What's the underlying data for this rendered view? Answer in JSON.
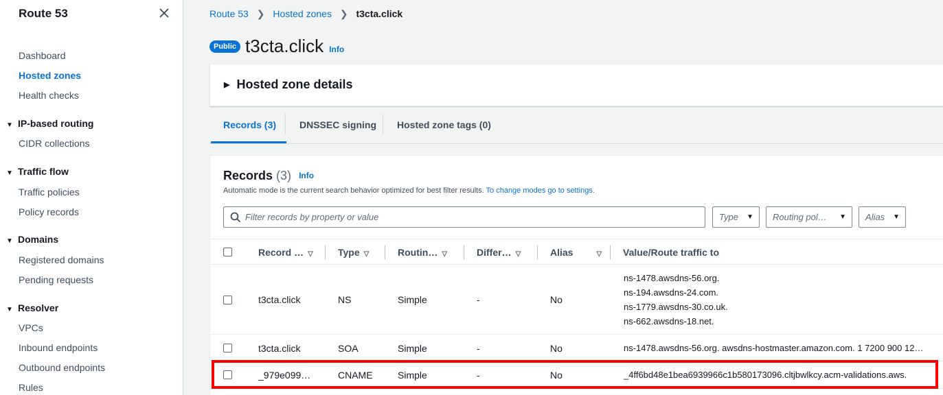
{
  "sidebar": {
    "title": "Route 53",
    "items": [
      {
        "label": "Dashboard"
      },
      {
        "label": "Hosted zones"
      },
      {
        "label": "Health checks"
      }
    ],
    "sections": [
      {
        "label": "IP-based routing",
        "items": [
          "CIDR collections"
        ]
      },
      {
        "label": "Traffic flow",
        "items": [
          "Traffic policies",
          "Policy records"
        ]
      },
      {
        "label": "Domains",
        "items": [
          "Registered domains",
          "Pending requests"
        ]
      },
      {
        "label": "Resolver",
        "items": [
          "VPCs",
          "Inbound endpoints",
          "Outbound endpoints",
          "Rules"
        ]
      }
    ]
  },
  "breadcrumb": [
    "Route 53",
    "Hosted zones",
    "t3cta.click"
  ],
  "zone": {
    "badge": "Public",
    "title": "t3cta.click",
    "info": "Info"
  },
  "details": {
    "label": "Hosted zone details"
  },
  "tabs": [
    {
      "label": "Records (3)",
      "active": true
    },
    {
      "label": "DNSSEC signing",
      "active": false
    },
    {
      "label": "Hosted zone tags (0)",
      "active": false
    }
  ],
  "records": {
    "title": "Records",
    "count": "(3)",
    "info": "Info",
    "description": "Automatic mode is the current search behavior optimized for best filter results.",
    "settings_link": "To change modes go to settings.",
    "filter_placeholder": "Filter records by property or value",
    "dropdowns": [
      "Type",
      "Routing pol…",
      "Alias"
    ],
    "columns": [
      "Record …",
      "Type",
      "Routin…",
      "Differ…",
      "Alias",
      "Value/Route traffic to"
    ],
    "rows": [
      {
        "name": "t3cta.click",
        "type": "NS",
        "routing": "Simple",
        "differ": "-",
        "alias": "No",
        "values": [
          "ns-1478.awsdns-56.org.",
          "ns-194.awsdns-24.com.",
          "ns-1779.awsdns-30.co.uk.",
          "ns-662.awsdns-18.net."
        ]
      },
      {
        "name": "t3cta.click",
        "type": "SOA",
        "routing": "Simple",
        "differ": "-",
        "alias": "No",
        "values": [
          "ns-1478.awsdns-56.org. awsdns-hostmaster.amazon.com. 1 7200 900 12…"
        ]
      },
      {
        "name": "_979e099…",
        "type": "CNAME",
        "routing": "Simple",
        "differ": "-",
        "alias": "No",
        "values": [
          "_4ff6bd48e1bea6939966c1b580173096.cltjbwlkcy.acm-validations.aws."
        ]
      }
    ]
  },
  "colors": {
    "accent": "#0972d3",
    "highlight": "#ff0000"
  }
}
